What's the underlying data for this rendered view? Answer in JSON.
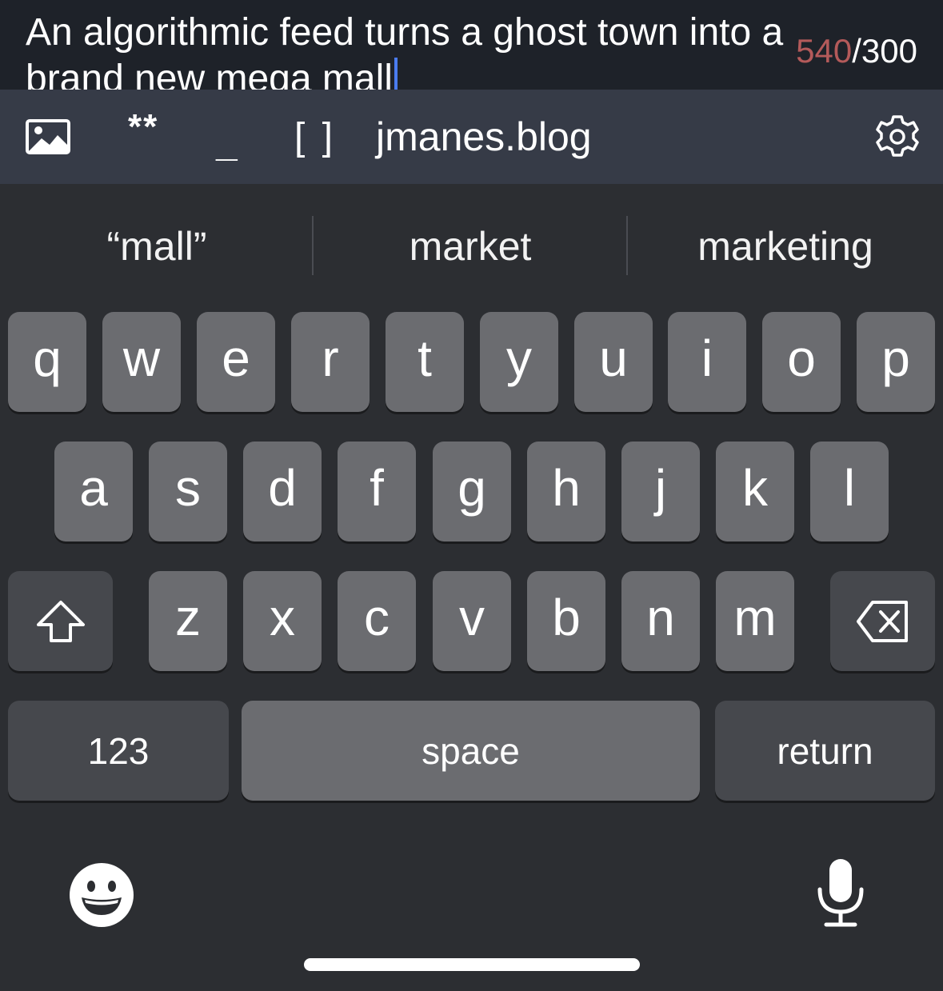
{
  "compose": {
    "text": "An algorithmic feed turns a ghost town into a brand new mega mall",
    "counter_current": "540",
    "counter_max": "/300"
  },
  "toolbar": {
    "image_icon": "image-icon",
    "bold_label": "**",
    "italic_label": "_",
    "link_label": "[ ]",
    "blog_label": "jmanes.blog",
    "settings_icon": "gear-icon"
  },
  "keyboard": {
    "suggestions": [
      "“mall”",
      "market",
      "marketing"
    ],
    "row1": [
      "q",
      "w",
      "e",
      "r",
      "t",
      "y",
      "u",
      "i",
      "o",
      "p"
    ],
    "row2": [
      "a",
      "s",
      "d",
      "f",
      "g",
      "h",
      "j",
      "k",
      "l"
    ],
    "row3": [
      "z",
      "x",
      "c",
      "v",
      "b",
      "n",
      "m"
    ],
    "numbers_label": "123",
    "space_label": "space",
    "return_label": "return",
    "shift_icon": "shift-icon",
    "backspace_icon": "backspace-icon",
    "emoji_icon": "emoji-icon",
    "mic_icon": "microphone-icon"
  },
  "colors": {
    "compose_bg": "#1e2229",
    "toolbar_bg": "#363b47",
    "keyboard_bg": "#2c2e32",
    "key_bg": "#6b6c70",
    "special_key_bg": "#46484d",
    "caret": "#4a7cf0",
    "counter_over": "#b45a5a"
  }
}
